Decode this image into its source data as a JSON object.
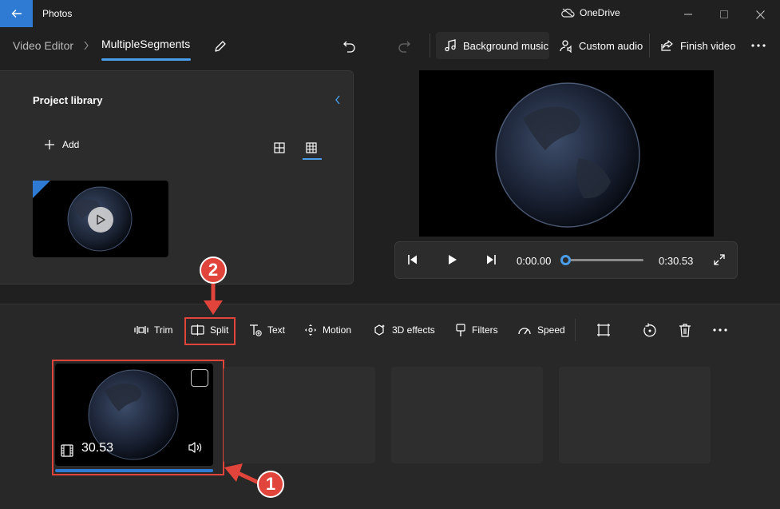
{
  "titlebar": {
    "app_title": "Photos",
    "onedrive_label": "OneDrive"
  },
  "toolbar": {
    "breadcrumb_root": "Video Editor",
    "project_name": "MultipleSegments",
    "background_music": "Background music",
    "custom_audio": "Custom audio",
    "finish_video": "Finish video"
  },
  "library": {
    "title": "Project library",
    "add_label": "Add"
  },
  "player": {
    "current_time": "0:00.00",
    "total_time": "0:30.53",
    "progress": 0
  },
  "storyboard": {
    "tools": [
      {
        "label": "Trim",
        "icon": "trim-icon"
      },
      {
        "label": "Split",
        "icon": "split-icon"
      },
      {
        "label": "Text",
        "icon": "text-icon"
      },
      {
        "label": "Motion",
        "icon": "motion-icon"
      },
      {
        "label": "3D effects",
        "icon": "3d-effects-icon"
      },
      {
        "label": "Filters",
        "icon": "filters-icon"
      },
      {
        "label": "Speed",
        "icon": "speed-icon"
      }
    ],
    "clip": {
      "duration": "30.53"
    }
  },
  "annotations": {
    "callout_1": "1",
    "callout_2": "2"
  },
  "colors": {
    "accent": "#2f7bd3",
    "highlight": "#e0443a",
    "background": "#202020"
  }
}
